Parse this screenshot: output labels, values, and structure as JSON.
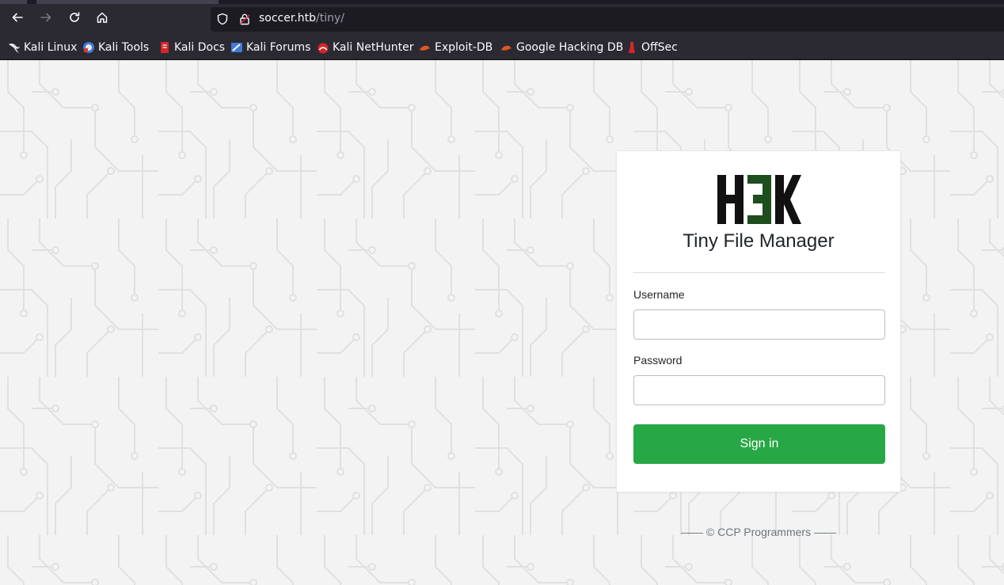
{
  "browser": {
    "url_host": "soccer.htb",
    "url_path": "/tiny/",
    "bookmarks": [
      {
        "label": "Kali Linux",
        "icon": "kali-dragon-icon"
      },
      {
        "label": "Kali Tools",
        "icon": "kali-tools-icon"
      },
      {
        "label": "Kali Docs",
        "icon": "kali-docs-icon"
      },
      {
        "label": "Kali Forums",
        "icon": "kali-forums-icon"
      },
      {
        "label": "Kali NetHunter",
        "icon": "kali-nethunter-icon"
      },
      {
        "label": "Exploit-DB",
        "icon": "exploit-db-icon"
      },
      {
        "label": "Google Hacking DB",
        "icon": "ghdb-icon"
      },
      {
        "label": "OffSec",
        "icon": "offsec-icon"
      }
    ]
  },
  "login": {
    "logo_text": "H3K",
    "title": "Tiny File Manager",
    "username_label": "Username",
    "username_value": "",
    "password_label": "Password",
    "password_value": "",
    "signin_label": "Sign in",
    "footer": "—— © CCP Programmers ——"
  },
  "colors": {
    "accent": "#28a745",
    "logo_dark": "#111111",
    "logo_green": "#1e4d1e"
  }
}
